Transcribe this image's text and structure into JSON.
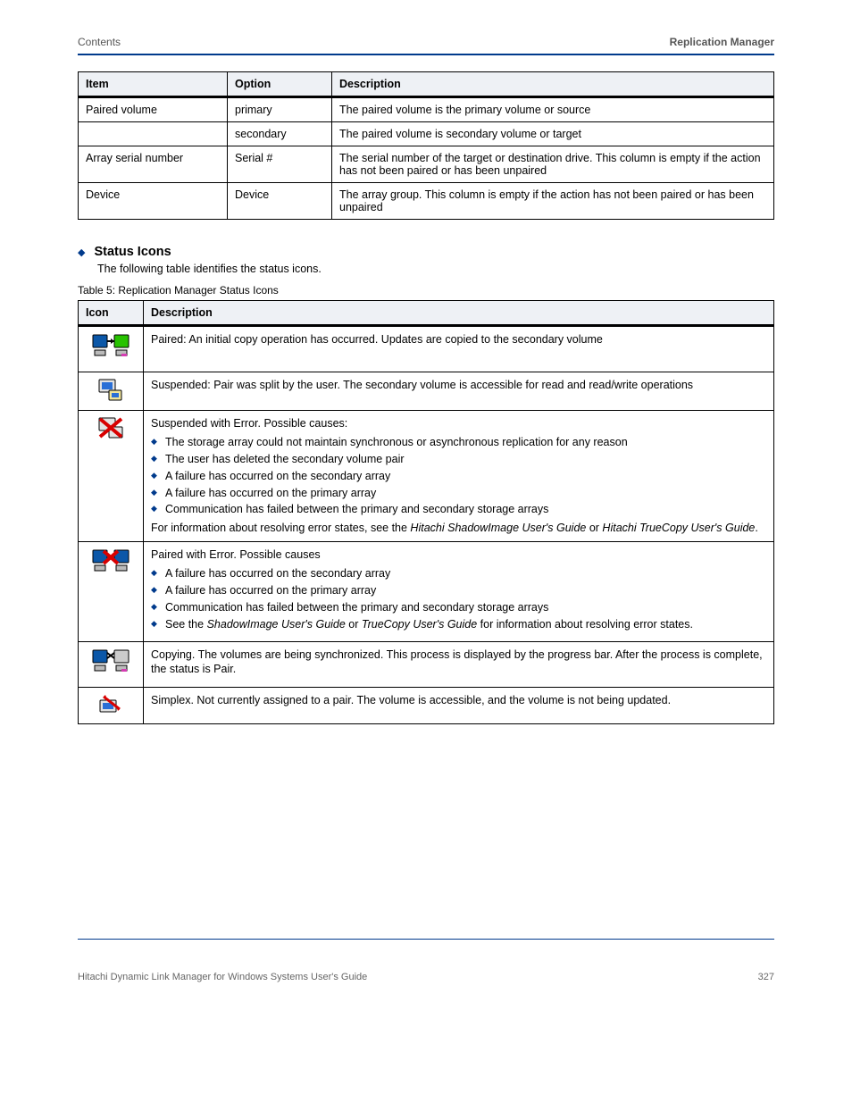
{
  "header": {
    "left": "Contents",
    "right": "Replication Manager"
  },
  "table1": {
    "cols": [
      "Item",
      "Option",
      "Description"
    ],
    "rows": [
      {
        "item": "Paired volume",
        "opt": "primary",
        "desc": "The paired volume is the primary volume or source"
      },
      {
        "item": "",
        "opt": "secondary",
        "desc": "The paired volume is secondary volume or target"
      },
      {
        "item": "Array serial number",
        "opt": "Serial #",
        "desc": "The serial number of the target or destination drive. This column is empty if the action has not been paired or has been unpaired"
      },
      {
        "item": "Device",
        "opt": "Device",
        "desc": "The array group. This column is empty if the action has not been paired or has been unpaired"
      }
    ]
  },
  "section": {
    "title": "Status Icons",
    "sub": "The following table identifies the status icons."
  },
  "table2": {
    "caption": "Table 5: Replication Manager Status Icons",
    "cols": [
      "Icon",
      "Description"
    ],
    "rows": [
      {
        "icon": "pair",
        "html": "Paired:  An initial copy operation has occurred. Updates are copied to the secondary volume"
      },
      {
        "icon": "susp",
        "html": "Suspended:  Pair was split by the user. The secondary volume is accessible for read and read/write operations"
      },
      {
        "icon": "suspx",
        "html": "Suspended with Error. Possible causes:",
        "bullets": [
          "The storage array could not maintain synchronous or asynchronous replication for any reason",
          "The user has deleted the secondary volume pair",
          "A failure has occurred on the secondary array",
          "A failure has occurred on the primary array",
          "Communication has failed between the primary and secondary storage arrays"
        ],
        "note": "For information about resolving error states, see the <span class='guide'>Hitachi ShadowImage User's Guide</span> or <span class='guide'>Hitachi TrueCopy User's Guide</span>."
      },
      {
        "icon": "pex",
        "html": "Paired with Error. Possible causes",
        "bullets": [
          "A failure has occurred on the secondary array",
          "A failure has occurred on the primary array",
          "Communication has failed between the primary and secondary storage arrays",
          "See the <span class='guide'>ShadowImage User's Guide</span> or <span class='guide'>TrueCopy User's Guide</span> for information about resolving error states."
        ]
      },
      {
        "icon": "copy",
        "html": "Copying. The volumes are being synchronized. This process is displayed by the progress bar. After the process is complete, the status is Pair."
      },
      {
        "icon": "simp",
        "html": "Simplex. Not currently assigned to a pair. The volume is accessible, and the volume is not being updated."
      }
    ]
  },
  "footer": {
    "left": "Hitachi Dynamic Link Manager for Windows Systems User's Guide",
    "right": "327"
  }
}
